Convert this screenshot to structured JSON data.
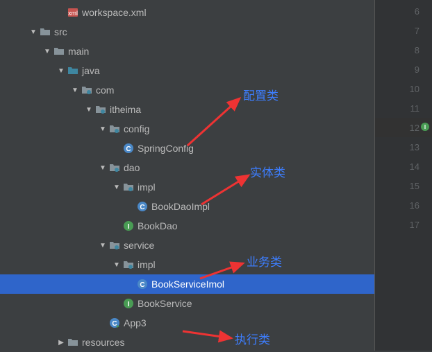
{
  "tree": [
    {
      "indent": 3,
      "arrow": "none",
      "icon": "xml",
      "name": "workspace.xml",
      "id": "file-workspace-xml",
      "selected": false
    },
    {
      "indent": 1,
      "arrow": "expanded",
      "icon": "dir",
      "name": "src",
      "id": "dir-src",
      "selected": false
    },
    {
      "indent": 2,
      "arrow": "expanded",
      "icon": "dir",
      "name": "main",
      "id": "dir-main",
      "selected": false
    },
    {
      "indent": 3,
      "arrow": "expanded",
      "icon": "src-dir",
      "name": "java",
      "id": "dir-java",
      "selected": false
    },
    {
      "indent": 4,
      "arrow": "expanded",
      "icon": "pkg",
      "name": "com",
      "id": "pkg-com",
      "selected": false
    },
    {
      "indent": 5,
      "arrow": "expanded",
      "icon": "pkg",
      "name": "itheima",
      "id": "pkg-itheima",
      "selected": false
    },
    {
      "indent": 6,
      "arrow": "expanded",
      "icon": "pkg",
      "name": "config",
      "id": "pkg-config",
      "selected": false
    },
    {
      "indent": 7,
      "arrow": "none",
      "icon": "class",
      "name": "SpringConfig",
      "id": "class-springconfig",
      "selected": false
    },
    {
      "indent": 6,
      "arrow": "expanded",
      "icon": "pkg",
      "name": "dao",
      "id": "pkg-dao",
      "selected": false
    },
    {
      "indent": 7,
      "arrow": "expanded",
      "icon": "pkg",
      "name": "impl",
      "id": "pkg-dao-impl",
      "selected": false
    },
    {
      "indent": 8,
      "arrow": "none",
      "icon": "class",
      "name": "BookDaoImpl",
      "id": "class-bookdaoimpl",
      "selected": false
    },
    {
      "indent": 7,
      "arrow": "none",
      "icon": "interface",
      "name": "BookDao",
      "id": "iface-bookdao",
      "selected": false
    },
    {
      "indent": 6,
      "arrow": "expanded",
      "icon": "pkg",
      "name": "service",
      "id": "pkg-service",
      "selected": false
    },
    {
      "indent": 7,
      "arrow": "expanded",
      "icon": "pkg",
      "name": "impl",
      "id": "pkg-service-impl",
      "selected": false
    },
    {
      "indent": 8,
      "arrow": "none",
      "icon": "class",
      "name": "BookServiceImol",
      "id": "class-bookserviceimol",
      "selected": true
    },
    {
      "indent": 7,
      "arrow": "none",
      "icon": "interface",
      "name": "BookService",
      "id": "iface-bookservice",
      "selected": false
    },
    {
      "indent": 6,
      "arrow": "none",
      "icon": "class-run",
      "name": "App3",
      "id": "class-app3",
      "selected": false
    },
    {
      "indent": 3,
      "arrow": "collapsed",
      "icon": "res-dir",
      "name": "resources",
      "id": "dir-resources",
      "selected": false
    }
  ],
  "gutter": [
    "6",
    "7",
    "8",
    "9",
    "10",
    "11",
    "12",
    "13",
    "14",
    "15",
    "16",
    "17"
  ],
  "gutter_highlight_index": 6,
  "annotations": {
    "config": "配置类",
    "entity": "实体类",
    "service": "业务类",
    "run": "执行类"
  }
}
